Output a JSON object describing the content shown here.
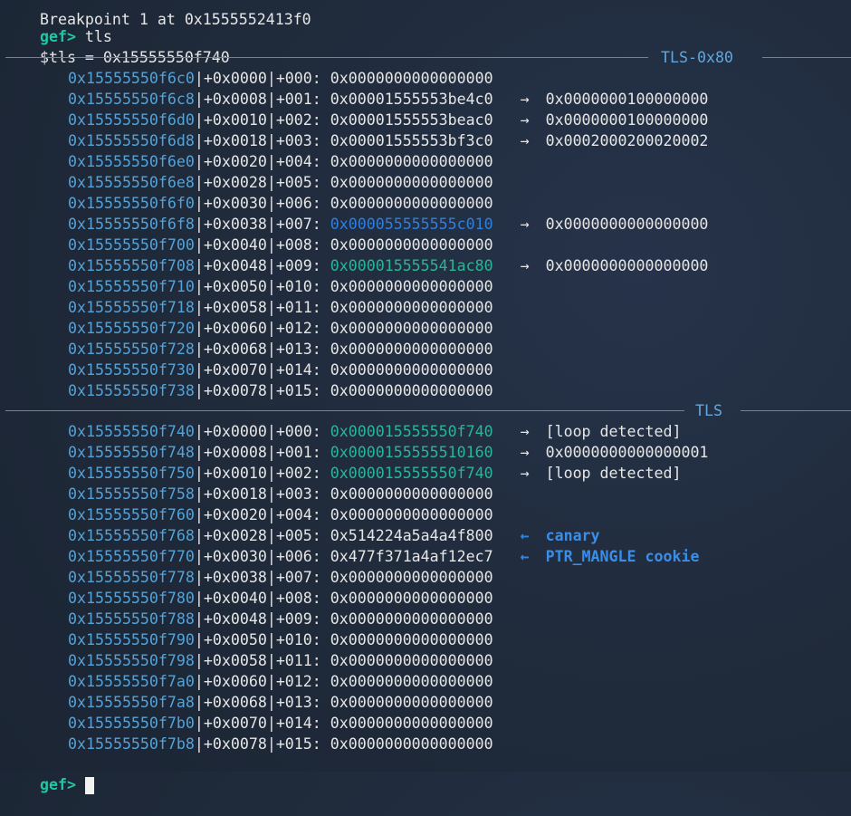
{
  "terminal": {
    "top_partial": "Breakpoint 1 at 0x1555552413f0",
    "prompt": "gef>",
    "command": " tls",
    "result": "$tls = 0x15555550f740",
    "sections": [
      {
        "title": "TLS-0x80",
        "rows": [
          {
            "addr": "0x15555550f6c0",
            "off": "+0x0000",
            "idx": "+000:",
            "val": "0x0000000000000000",
            "val_color": "default",
            "arrow": "",
            "deref": ""
          },
          {
            "addr": "0x15555550f6c8",
            "off": "+0x0008",
            "idx": "+001:",
            "val": "0x00001555553be4c0",
            "val_color": "default",
            "arrow": "→",
            "deref": "0x0000000100000000"
          },
          {
            "addr": "0x15555550f6d0",
            "off": "+0x0010",
            "idx": "+002:",
            "val": "0x00001555553beac0",
            "val_color": "default",
            "arrow": "→",
            "deref": "0x0000000100000000"
          },
          {
            "addr": "0x15555550f6d8",
            "off": "+0x0018",
            "idx": "+003:",
            "val": "0x00001555553bf3c0",
            "val_color": "default",
            "arrow": "→",
            "deref": "0x0002000200020002"
          },
          {
            "addr": "0x15555550f6e0",
            "off": "+0x0020",
            "idx": "+004:",
            "val": "0x0000000000000000",
            "val_color": "default",
            "arrow": "",
            "deref": ""
          },
          {
            "addr": "0x15555550f6e8",
            "off": "+0x0028",
            "idx": "+005:",
            "val": "0x0000000000000000",
            "val_color": "default",
            "arrow": "",
            "deref": ""
          },
          {
            "addr": "0x15555550f6f0",
            "off": "+0x0030",
            "idx": "+006:",
            "val": "0x0000000000000000",
            "val_color": "default",
            "arrow": "",
            "deref": ""
          },
          {
            "addr": "0x15555550f6f8",
            "off": "+0x0038",
            "idx": "+007:",
            "val": "0x000055555555c010",
            "val_color": "blue",
            "arrow": "→",
            "deref": "0x0000000000000000"
          },
          {
            "addr": "0x15555550f700",
            "off": "+0x0040",
            "idx": "+008:",
            "val": "0x0000000000000000",
            "val_color": "default",
            "arrow": "",
            "deref": ""
          },
          {
            "addr": "0x15555550f708",
            "off": "+0x0048",
            "idx": "+009:",
            "val": "0x000015555541ac80",
            "val_color": "teal",
            "arrow": "→",
            "deref": "0x0000000000000000"
          },
          {
            "addr": "0x15555550f710",
            "off": "+0x0050",
            "idx": "+010:",
            "val": "0x0000000000000000",
            "val_color": "default",
            "arrow": "",
            "deref": ""
          },
          {
            "addr": "0x15555550f718",
            "off": "+0x0058",
            "idx": "+011:",
            "val": "0x0000000000000000",
            "val_color": "default",
            "arrow": "",
            "deref": ""
          },
          {
            "addr": "0x15555550f720",
            "off": "+0x0060",
            "idx": "+012:",
            "val": "0x0000000000000000",
            "val_color": "default",
            "arrow": "",
            "deref": ""
          },
          {
            "addr": "0x15555550f728",
            "off": "+0x0068",
            "idx": "+013:",
            "val": "0x0000000000000000",
            "val_color": "default",
            "arrow": "",
            "deref": ""
          },
          {
            "addr": "0x15555550f730",
            "off": "+0x0070",
            "idx": "+014:",
            "val": "0x0000000000000000",
            "val_color": "default",
            "arrow": "",
            "deref": ""
          },
          {
            "addr": "0x15555550f738",
            "off": "+0x0078",
            "idx": "+015:",
            "val": "0x0000000000000000",
            "val_color": "default",
            "arrow": "",
            "deref": ""
          }
        ]
      },
      {
        "title": "TLS",
        "rows": [
          {
            "addr": "0x15555550f740",
            "off": "+0x0000",
            "idx": "+000:",
            "val": "0x000015555550f740",
            "val_color": "teal",
            "arrow": "→",
            "deref": "[loop detected]"
          },
          {
            "addr": "0x15555550f748",
            "off": "+0x0008",
            "idx": "+001:",
            "val": "0x0000155555510160",
            "val_color": "teal",
            "arrow": "→",
            "deref": "0x0000000000000001"
          },
          {
            "addr": "0x15555550f750",
            "off": "+0x0010",
            "idx": "+002:",
            "val": "0x000015555550f740",
            "val_color": "teal",
            "arrow": "→",
            "deref": "[loop detected]"
          },
          {
            "addr": "0x15555550f758",
            "off": "+0x0018",
            "idx": "+003:",
            "val": "0x0000000000000000",
            "val_color": "default",
            "arrow": "",
            "deref": ""
          },
          {
            "addr": "0x15555550f760",
            "off": "+0x0020",
            "idx": "+004:",
            "val": "0x0000000000000000",
            "val_color": "default",
            "arrow": "",
            "deref": ""
          },
          {
            "addr": "0x15555550f768",
            "off": "+0x0028",
            "idx": "+005:",
            "val": "0x514224a5a4a4f800",
            "val_color": "default",
            "arrow": "←",
            "deref": "canary",
            "note": true
          },
          {
            "addr": "0x15555550f770",
            "off": "+0x0030",
            "idx": "+006:",
            "val": "0x477f371a4af12ec7",
            "val_color": "default",
            "arrow": "←",
            "deref": "PTR_MANGLE cookie",
            "note": true
          },
          {
            "addr": "0x15555550f778",
            "off": "+0x0038",
            "idx": "+007:",
            "val": "0x0000000000000000",
            "val_color": "default",
            "arrow": "",
            "deref": ""
          },
          {
            "addr": "0x15555550f780",
            "off": "+0x0040",
            "idx": "+008:",
            "val": "0x0000000000000000",
            "val_color": "default",
            "arrow": "",
            "deref": ""
          },
          {
            "addr": "0x15555550f788",
            "off": "+0x0048",
            "idx": "+009:",
            "val": "0x0000000000000000",
            "val_color": "default",
            "arrow": "",
            "deref": ""
          },
          {
            "addr": "0x15555550f790",
            "off": "+0x0050",
            "idx": "+010:",
            "val": "0x0000000000000000",
            "val_color": "default",
            "arrow": "",
            "deref": ""
          },
          {
            "addr": "0x15555550f798",
            "off": "+0x0058",
            "idx": "+011:",
            "val": "0x0000000000000000",
            "val_color": "default",
            "arrow": "",
            "deref": ""
          },
          {
            "addr": "0x15555550f7a0",
            "off": "+0x0060",
            "idx": "+012:",
            "val": "0x0000000000000000",
            "val_color": "default",
            "arrow": "",
            "deref": ""
          },
          {
            "addr": "0x15555550f7a8",
            "off": "+0x0068",
            "idx": "+013:",
            "val": "0x0000000000000000",
            "val_color": "default",
            "arrow": "",
            "deref": ""
          },
          {
            "addr": "0x15555550f7b0",
            "off": "+0x0070",
            "idx": "+014:",
            "val": "0x0000000000000000",
            "val_color": "default",
            "arrow": "",
            "deref": ""
          },
          {
            "addr": "0x15555550f7b8",
            "off": "+0x0078",
            "idx": "+015:",
            "val": "0x0000000000000000",
            "val_color": "default",
            "arrow": "",
            "deref": ""
          }
        ]
      }
    ],
    "final_prompt": "gef>"
  },
  "colors": {
    "background": "#1f2a3a",
    "prompt": "#1fc7a3",
    "address": "#55a2d8",
    "teal_value": "#2ab598",
    "blue_value": "#2f7fe0",
    "annotation": "#3a8ee8"
  }
}
